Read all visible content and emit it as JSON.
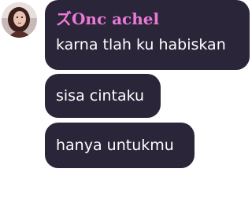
{
  "sender": {
    "name": "ズOnc achel",
    "name_color": "#e97ad6"
  },
  "bubble_color": "#2a2538",
  "messages": [
    {
      "text": "karna tlah ku habiskan"
    },
    {
      "text": "sisa cintaku"
    },
    {
      "text": "hanya untukmu"
    }
  ],
  "avatar": {
    "icon": "profile-photo"
  }
}
